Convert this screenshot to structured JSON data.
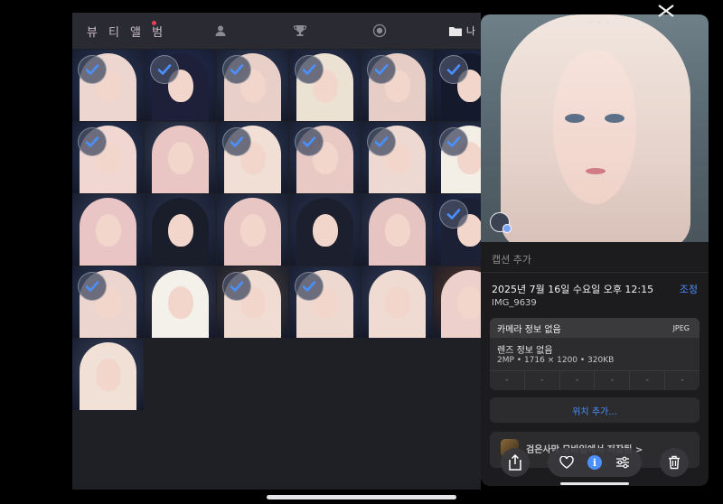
{
  "game": {
    "tabs": [
      {
        "label": "뷰 티 앨 범",
        "icon": "beauty-album"
      },
      {
        "label": "",
        "icon": "person-icon"
      },
      {
        "label": "",
        "icon": "trophy-icon"
      },
      {
        "label": "",
        "icon": "badge-icon"
      },
      {
        "label": "나",
        "icon": "folder-icon"
      }
    ],
    "thumbnails": [
      {
        "checked": true,
        "hair": "#ecd6cf",
        "bg": "#2b3a5c"
      },
      {
        "checked": true,
        "hair": "#1d2038",
        "bg": "#25305a"
      },
      {
        "checked": true,
        "hair": "#e8cfc8",
        "bg": "#31405f"
      },
      {
        "checked": true,
        "hair": "#ece2d4",
        "bg": "#2b3556"
      },
      {
        "checked": true,
        "hair": "#e6cdc5",
        "bg": "#31415f"
      },
      {
        "checked": true,
        "hair": "#141a2c",
        "bg": "#1f2b4d"
      },
      {
        "checked": true,
        "hair": "#f0d7d2",
        "bg": "#2a3a5b"
      },
      {
        "checked": false,
        "hair": "#e9c6c4",
        "bg": "#3a4660"
      },
      {
        "checked": true,
        "hair": "#f1dfd6",
        "bg": "#2d3c5c"
      },
      {
        "checked": true,
        "hair": "#e9c9c3",
        "bg": "#2f3f61"
      },
      {
        "checked": true,
        "hair": "#edd9d1",
        "bg": "#2b3a5a"
      },
      {
        "checked": true,
        "hair": "#f3eee6",
        "bg": "#2a3656"
      },
      {
        "checked": false,
        "hair": "#e9c5c5",
        "bg": "#35415e"
      },
      {
        "checked": false,
        "hair": "#1a1d2a",
        "bg": "#2e3957"
      },
      {
        "checked": false,
        "hair": "#e8c6c4",
        "bg": "#34405d"
      },
      {
        "checked": false,
        "hair": "#1c1f2d",
        "bg": "#2c3756"
      },
      {
        "checked": false,
        "hair": "#e6c4c2",
        "bg": "#353f5c"
      },
      {
        "checked": true,
        "hair": "#1b2034",
        "bg": "#25305a"
      },
      {
        "checked": true,
        "hair": "#edd5cf",
        "bg": "#2c3b5b"
      },
      {
        "checked": false,
        "hair": "#f4f0ea",
        "bg": "#3b4155"
      },
      {
        "checked": true,
        "hair": "#f0dcd2",
        "bg": "#4b4440"
      },
      {
        "checked": true,
        "hair": "#eed9d0",
        "bg": "#2d3b5b"
      },
      {
        "checked": false,
        "hair": "#efdbd2",
        "bg": "#344160"
      },
      {
        "checked": false,
        "hair": "#edd0cc",
        "bg": "#5a3a2a"
      },
      {
        "checked": false,
        "hair": "#f0e0d6",
        "bg": "#3a4560"
      }
    ]
  },
  "panel": {
    "caption_placeholder": "캡션 추가",
    "datetime": "2025년 7월 16일 수요일 오후 12:15",
    "adjust_label": "조정",
    "filename": "IMG_9639",
    "camera_info": "카메라 정보 없음",
    "format": "JPEG",
    "lens_info": "렌즈 정보 없음",
    "specs": "2MP • 1716 × 1200 • 320KB",
    "exif_values": [
      "-",
      "-",
      "-",
      "-",
      "-",
      "-"
    ],
    "location_button": "위치 추가...",
    "app_source": "검은사막 모바일에서 저장됨 >"
  },
  "colors": {
    "accent": "#4a90ff",
    "panel_bg": "#1c1c1e",
    "card_bg": "#2c2c2e",
    "game_bg": "#1f2026"
  }
}
